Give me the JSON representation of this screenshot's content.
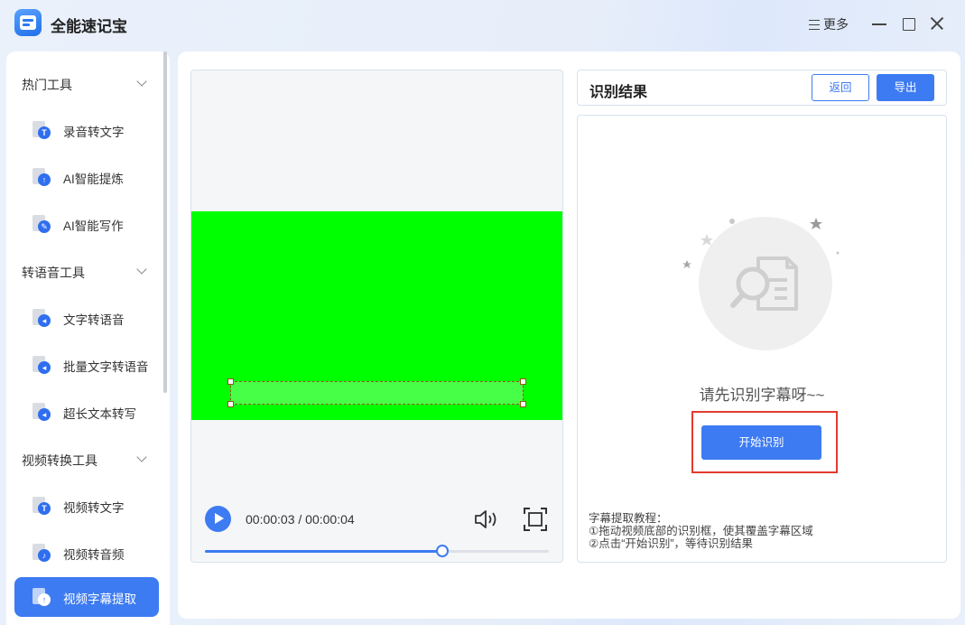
{
  "app": {
    "title": "全能速记宝",
    "more_label": "更多"
  },
  "sidebar": {
    "groups": [
      {
        "label": "热门工具",
        "items": [
          {
            "label": "录音转文字",
            "icon": "T"
          },
          {
            "label": "AI智能提炼",
            "icon": "↑"
          },
          {
            "label": "AI智能写作",
            "icon": "✎"
          }
        ]
      },
      {
        "label": "转语音工具",
        "items": [
          {
            "label": "文字转语音",
            "icon": "◂"
          },
          {
            "label": "批量文字转语音",
            "icon": "◂"
          },
          {
            "label": "超长文本转写",
            "icon": "◂"
          }
        ]
      },
      {
        "label": "视频转换工具",
        "items": [
          {
            "label": "视频转文字",
            "icon": "T"
          },
          {
            "label": "视频转音频",
            "icon": "♪"
          },
          {
            "label": "视频字幕提取",
            "icon": "↑",
            "active": true
          }
        ]
      }
    ]
  },
  "player": {
    "current_time": "00:00:03",
    "total_time": "00:00:04",
    "progress": 0.69,
    "video_color": "#00ff00"
  },
  "result": {
    "title": "识别结果",
    "back_label": "返回",
    "export_label": "导出",
    "empty_text": "请先识别字幕呀~~",
    "start_label": "开始识别",
    "tutorial_title": "字幕提取教程：",
    "tutorial_step1": "①拖动视频底部的识别框，使其覆盖字幕区域",
    "tutorial_step2": "②点击“开始识别”，等待识别结果"
  },
  "colors": {
    "accent": "#3d7bf2",
    "highlight": "#e23b2e"
  }
}
